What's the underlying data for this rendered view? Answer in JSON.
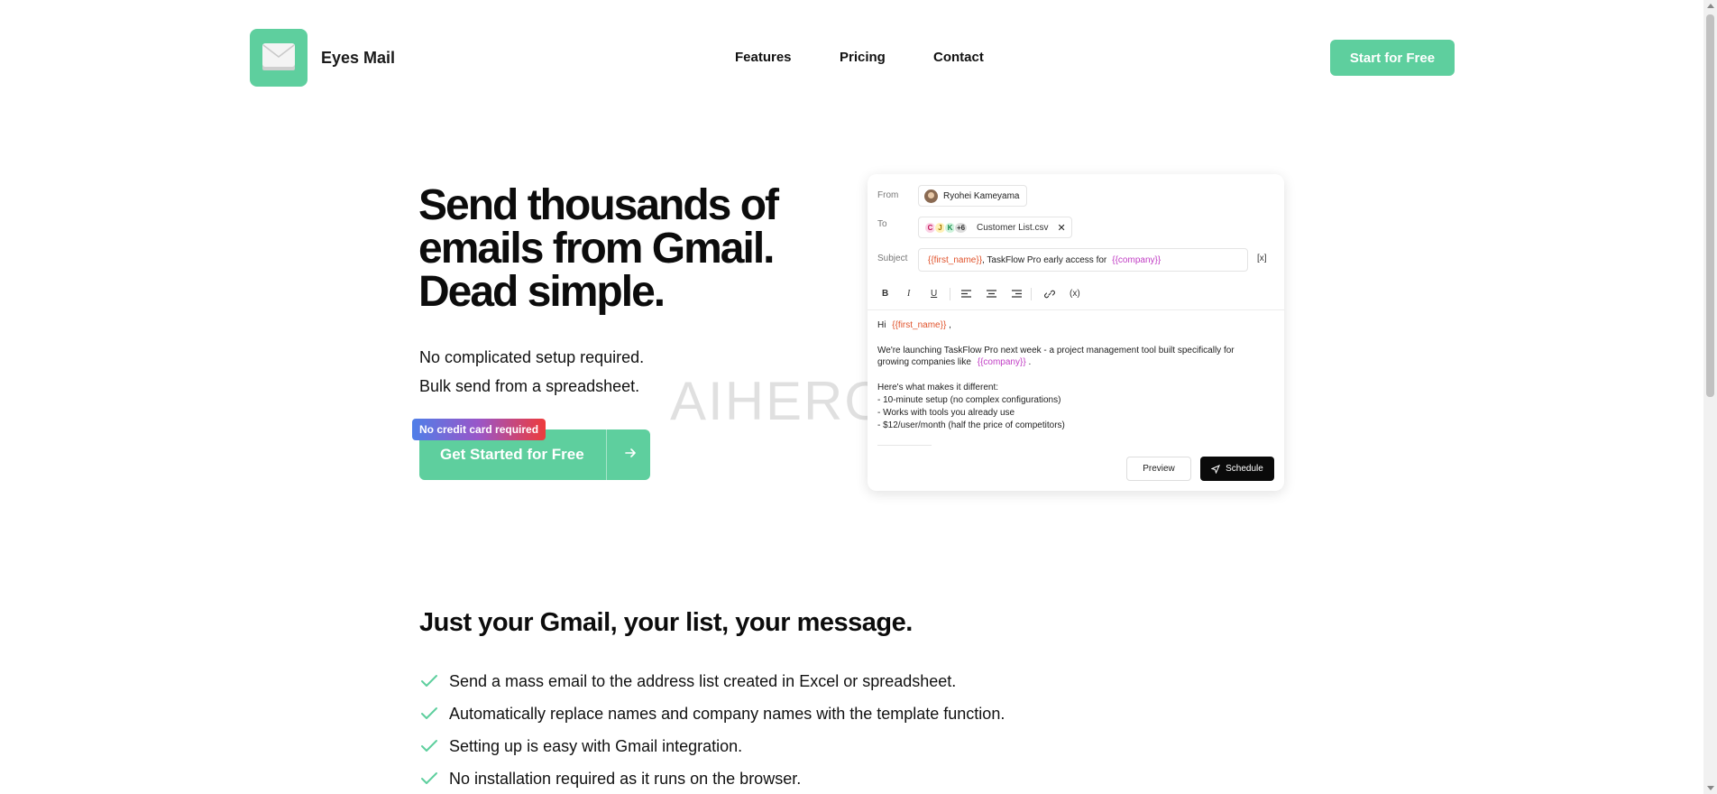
{
  "header": {
    "brand": "Eyes Mail",
    "nav": [
      "Features",
      "Pricing",
      "Contact"
    ],
    "cta": "Start for Free"
  },
  "hero": {
    "title_lines": [
      "Send thousands of",
      "emails from Gmail.",
      "Dead simple."
    ],
    "subtitle_lines": [
      "No complicated setup required.",
      "Bulk send from a spreadsheet."
    ],
    "badge": "No credit card required",
    "cta": "Get Started for Free",
    "cta_icon": "arrow-right-icon"
  },
  "watermark": "AIHEROM.COM",
  "email_card": {
    "from_label": "From",
    "from_name": "Ryohei Kameyama",
    "to_label": "To",
    "to_initials": [
      "C",
      "J",
      "K",
      "+6"
    ],
    "to_file": "Customer List.csv",
    "to_remove": "✕",
    "subject_label": "Subject",
    "subject_var1": "{{first_name}}",
    "subject_text": ", TaskFlow Pro early access for",
    "subject_var2": "{{company}}",
    "variable_button": "[x]",
    "toolbar": [
      "B",
      "I",
      "U",
      "left-align-icon",
      "center-align-icon",
      "right-align-icon",
      "link-icon",
      "(x)"
    ],
    "body": {
      "greeting": "Hi",
      "greeting_var": "{{first_name}}",
      "greeting_end": ",",
      "para1_line1": "We're launching TaskFlow Pro next week - a project management tool built specifically for",
      "para1_line2": "growing companies like",
      "para1_var": "{{company}}",
      "para1_end": ".",
      "list_intro": "Here's what makes it different:",
      "list_items": [
        "- 10-minute setup (no complex configurations)",
        "- Works with tools you already use",
        "- $12/user/month (half the price of competitors)"
      ]
    },
    "preview_button": "Preview",
    "schedule_button": "Schedule"
  },
  "section2": {
    "title": "Just your Gmail, your list, your message.",
    "features": [
      "Send a mass email to the address list created in Excel or spreadsheet.",
      "Automatically replace names and company names with the template function.",
      "Setting up is easy with Gmail integration.",
      "No installation required as it runs on the browser."
    ]
  },
  "colors": {
    "accent": "#5ecf9e",
    "text": "#111111",
    "variable_red": "#e0522b",
    "variable_pink": "#c03cc4",
    "badge_gradient": [
      "#4f7fe8",
      "#9a56c8",
      "#ee3b3b"
    ]
  }
}
